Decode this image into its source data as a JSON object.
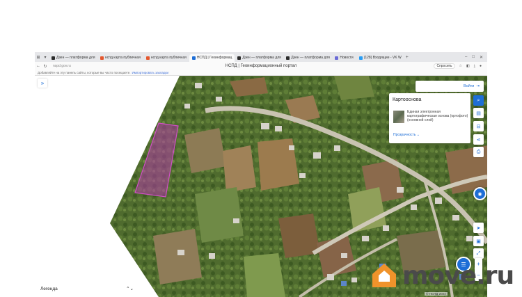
{
  "tabs": [
    {
      "label": "Дзен — платформа для",
      "color": "#2b2b2b"
    },
    {
      "label": "нспд карта публичная",
      "color": "#e4572e"
    },
    {
      "label": "нспд карта публичная",
      "color": "#e4572e"
    },
    {
      "label": "НСПД | Геоинформац",
      "color": "#1e6ed6",
      "active": true
    },
    {
      "label": "Дзен — платформа для",
      "color": "#2b2b2b"
    },
    {
      "label": "Дзен — платформа для",
      "color": "#2b2b2b"
    },
    {
      "label": "Новости",
      "color": "#6b6bd6"
    },
    {
      "label": "(128) Входящие - VK W",
      "color": "#2a9df4"
    }
  ],
  "address": {
    "url": "nspd.gov.ru",
    "page_title": "НСПД | Геоинформационный портал",
    "ask_label": "Спросить"
  },
  "bookmarks": {
    "text": "Добавляйте на эту панель сайты, которые вы часто посещаете.",
    "link": "Импортировать закладки"
  },
  "map": {
    "search_label": "Войти",
    "panel": {
      "title": "Картооснова",
      "description": "Единая электронная картографическая основа (ортофото)(основной слой)",
      "control_label": "Прозрачность"
    },
    "legend_label": "Легенда",
    "scale_text": "© НСПД 2024",
    "highlight_color": "#b23aa8"
  },
  "watermark": {
    "text": "move.ru",
    "icon_color": "#f0932b"
  }
}
